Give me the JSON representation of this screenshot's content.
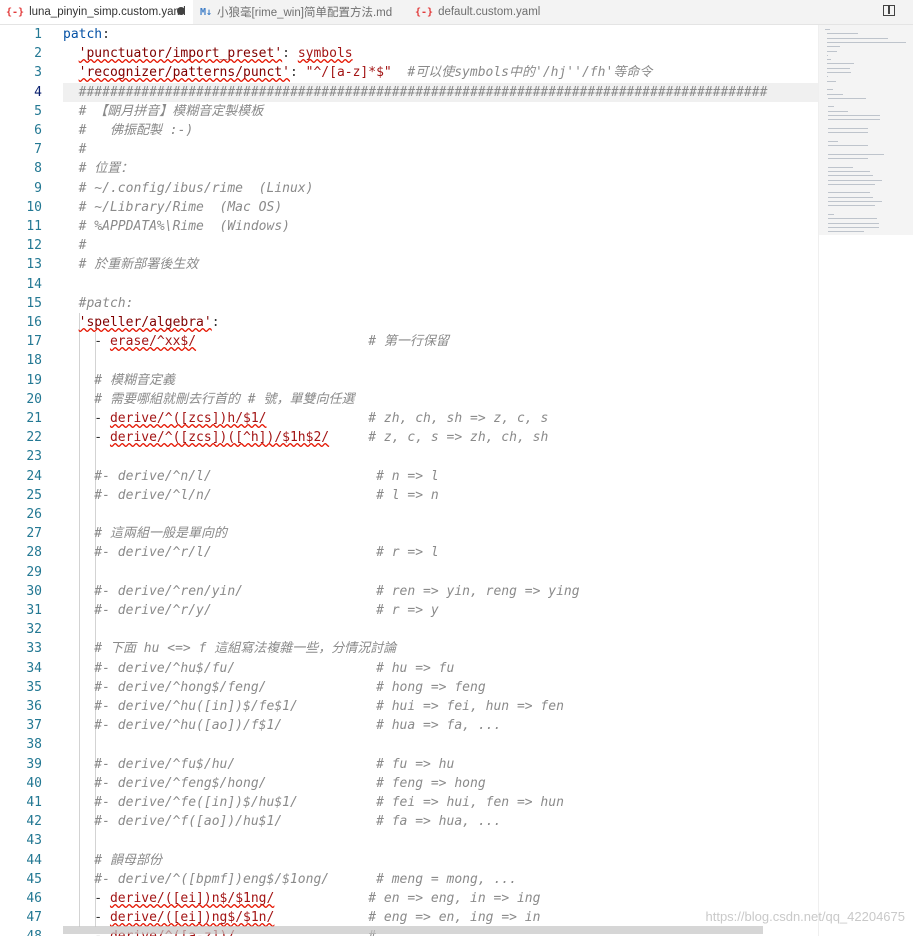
{
  "tabs": [
    {
      "icon": "{-}",
      "label": "luna_pinyin_simp.custom.yaml",
      "modified": true,
      "active": true
    },
    {
      "icon": "M↓",
      "label": "小狼毫[rime_win]简单配置方法.md",
      "modified": false,
      "active": false
    },
    {
      "icon": "{-}",
      "label": "default.custom.yaml",
      "modified": false,
      "active": false
    }
  ],
  "editor": {
    "current_line": 4,
    "lines": [
      {
        "n": "1",
        "segs": [
          [
            "patch",
            ":",
            "k"
          ],
          [
            "",
            ":",
            "d"
          ]
        ]
      },
      {
        "n": "2"
      },
      {
        "n": "3"
      },
      {
        "n": "4"
      },
      {
        "n": "5"
      },
      {
        "n": "6"
      },
      {
        "n": "7"
      },
      {
        "n": "8"
      },
      {
        "n": "9"
      },
      {
        "n": "10"
      },
      {
        "n": "11"
      },
      {
        "n": "12"
      },
      {
        "n": "13"
      },
      {
        "n": "14"
      },
      {
        "n": "15"
      },
      {
        "n": "16"
      },
      {
        "n": "17"
      },
      {
        "n": "18"
      },
      {
        "n": "19"
      },
      {
        "n": "20"
      },
      {
        "n": "21"
      },
      {
        "n": "22"
      },
      {
        "n": "23"
      },
      {
        "n": "24"
      },
      {
        "n": "25"
      },
      {
        "n": "26"
      },
      {
        "n": "27"
      },
      {
        "n": "28"
      },
      {
        "n": "29"
      },
      {
        "n": "30"
      },
      {
        "n": "31"
      },
      {
        "n": "32"
      },
      {
        "n": "33"
      },
      {
        "n": "34"
      },
      {
        "n": "35"
      },
      {
        "n": "36"
      },
      {
        "n": "37"
      },
      {
        "n": "38"
      },
      {
        "n": "39"
      },
      {
        "n": "40"
      },
      {
        "n": "41"
      },
      {
        "n": "42"
      },
      {
        "n": "43"
      },
      {
        "n": "44"
      },
      {
        "n": "45"
      },
      {
        "n": "46"
      },
      {
        "n": "47"
      },
      {
        "n": "48"
      }
    ],
    "code": [
      [
        {
          "t": "patch",
          "c": "c-blue"
        },
        {
          "t": ":",
          "c": "c-def"
        }
      ],
      [
        {
          "t": "  ",
          "c": "c-def"
        },
        {
          "t": "'punctuator/import_preset'",
          "c": "c-key"
        },
        {
          "t": ": ",
          "c": "c-def"
        },
        {
          "t": "symbols",
          "c": "c-str"
        }
      ],
      [
        {
          "t": "  ",
          "c": "c-def"
        },
        {
          "t": "'recognizer/patterns/punct'",
          "c": "c-key"
        },
        {
          "t": ": ",
          "c": "c-def"
        },
        {
          "t": "\"^/[a-z]*$\"",
          "c": "c-str"
        },
        {
          "t": "  #可以使symbols中的'/hj''/fh'等命令",
          "c": "c-com"
        }
      ],
      [
        {
          "t": "  ########################################################################################",
          "c": "c-com"
        }
      ],
      [
        {
          "t": "  # 【朙月拼音】模糊音定製模板",
          "c": "c-com"
        }
      ],
      [
        {
          "t": "  #   佛振配製 :-)",
          "c": "c-com"
        }
      ],
      [
        {
          "t": "  #",
          "c": "c-com"
        }
      ],
      [
        {
          "t": "  # 位置：",
          "c": "c-com"
        }
      ],
      [
        {
          "t": "  # ~/.config/ibus/rime  (Linux)",
          "c": "c-com"
        }
      ],
      [
        {
          "t": "  # ~/Library/Rime  (Mac OS)",
          "c": "c-com"
        }
      ],
      [
        {
          "t": "  # %APPDATA%\\Rime  (Windows)",
          "c": "c-com"
        }
      ],
      [
        {
          "t": "  #",
          "c": "c-com"
        }
      ],
      [
        {
          "t": "  # 於重新部署後生效",
          "c": "c-com"
        }
      ],
      [],
      [
        {
          "t": "  #patch:",
          "c": "c-com"
        }
      ],
      [
        {
          "t": "  ",
          "c": "c-def"
        },
        {
          "t": "'speller/algebra'",
          "c": "c-key"
        },
        {
          "t": ":",
          "c": "c-def"
        }
      ],
      [
        {
          "t": "    - ",
          "c": "c-def"
        },
        {
          "t": "erase/^xx$/",
          "c": "c-str"
        },
        {
          "t": "                      # 第一行保留",
          "c": "c-com"
        }
      ],
      [],
      [
        {
          "t": "    # 模糊音定義",
          "c": "c-com"
        }
      ],
      [
        {
          "t": "    # 需要哪組就刪去行首的 # 號，單雙向任選",
          "c": "c-com"
        }
      ],
      [
        {
          "t": "    - ",
          "c": "c-def"
        },
        {
          "t": "derive/^([zcs])h/$1/",
          "c": "c-str"
        },
        {
          "t": "             # zh, ch, sh => z, c, s",
          "c": "c-com"
        }
      ],
      [
        {
          "t": "    - ",
          "c": "c-def"
        },
        {
          "t": "derive/^([zcs])([^h])/$1h$2/",
          "c": "c-str"
        },
        {
          "t": "     # z, c, s => zh, ch, sh",
          "c": "c-com"
        }
      ],
      [],
      [
        {
          "t": "    #- derive/^n/l/                     # n => l",
          "c": "c-com"
        }
      ],
      [
        {
          "t": "    #- derive/^l/n/                     # l => n",
          "c": "c-com"
        }
      ],
      [],
      [
        {
          "t": "    # 這兩組一般是單向的",
          "c": "c-com"
        }
      ],
      [
        {
          "t": "    #- derive/^r/l/                     # r => l",
          "c": "c-com"
        }
      ],
      [],
      [
        {
          "t": "    #- derive/^ren/yin/                 # ren => yin, reng => ying",
          "c": "c-com"
        }
      ],
      [
        {
          "t": "    #- derive/^r/y/                     # r => y",
          "c": "c-com"
        }
      ],
      [],
      [
        {
          "t": "    # 下面 hu <=> f 這組寫法複雜一些，分情況討論",
          "c": "c-com"
        }
      ],
      [
        {
          "t": "    #- derive/^hu$/fu/                  # hu => fu",
          "c": "c-com"
        }
      ],
      [
        {
          "t": "    #- derive/^hong$/feng/              # hong => feng",
          "c": "c-com"
        }
      ],
      [
        {
          "t": "    #- derive/^hu([in])$/fe$1/          # hui => fei, hun => fen",
          "c": "c-com"
        }
      ],
      [
        {
          "t": "    #- derive/^hu([ao])/f$1/            # hua => fa, ...",
          "c": "c-com"
        }
      ],
      [],
      [
        {
          "t": "    #- derive/^fu$/hu/                  # fu => hu",
          "c": "c-com"
        }
      ],
      [
        {
          "t": "    #- derive/^feng$/hong/              # feng => hong",
          "c": "c-com"
        }
      ],
      [
        {
          "t": "    #- derive/^fe([in])$/hu$1/          # fei => hui, fen => hun",
          "c": "c-com"
        }
      ],
      [
        {
          "t": "    #- derive/^f([ao])/hu$1/            # fa => hua, ...",
          "c": "c-com"
        }
      ],
      [],
      [
        {
          "t": "    # 韻母部份",
          "c": "c-com"
        }
      ],
      [
        {
          "t": "    #- derive/^([bpmf])eng$/$1ong/      # meng = mong, ...",
          "c": "c-com"
        }
      ],
      [
        {
          "t": "    - ",
          "c": "c-def"
        },
        {
          "t": "derive/([ei])n$/$1ng/",
          "c": "c-str"
        },
        {
          "t": "            # en => eng, in => ing",
          "c": "c-com"
        }
      ],
      [
        {
          "t": "    - ",
          "c": "c-def"
        },
        {
          "t": "derive/([ei])ng$/$1n/",
          "c": "c-str"
        },
        {
          "t": "            # eng => en, ing => in",
          "c": "c-com"
        }
      ],
      [
        {
          "t": "    - ",
          "c": "c-def"
        },
        {
          "t": "derive/^([a-z])/...",
          "c": "c-str"
        },
        {
          "t": "              # ...",
          "c": "c-com"
        }
      ]
    ]
  },
  "watermark": "https://blog.csdn.net/qq_42204675",
  "colors": {
    "line_number": "#237893",
    "comment": "#8a8a8a",
    "key": "#800000",
    "string": "#a31515",
    "keyword": "#0451a5"
  }
}
